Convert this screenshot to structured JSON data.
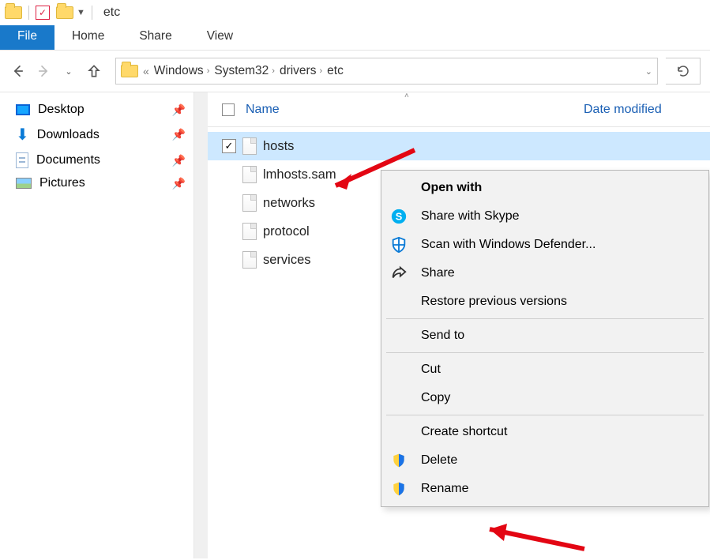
{
  "window": {
    "title": "etc"
  },
  "ribbon": {
    "tabs": {
      "file": "File",
      "home": "Home",
      "share": "Share",
      "view": "View"
    }
  },
  "breadcrumb": {
    "items": [
      "Windows",
      "System32",
      "drivers",
      "etc"
    ]
  },
  "columns": {
    "name": "Name",
    "date_modified": "Date modified"
  },
  "sidebar": {
    "items": [
      {
        "label": "Desktop"
      },
      {
        "label": "Downloads"
      },
      {
        "label": "Documents"
      },
      {
        "label": "Pictures"
      }
    ]
  },
  "files": [
    {
      "name": "hosts",
      "selected": true
    },
    {
      "name": "lmhosts.sam",
      "selected": false
    },
    {
      "name": "networks",
      "selected": false
    },
    {
      "name": "protocol",
      "selected": false
    },
    {
      "name": "services",
      "selected": false
    }
  ],
  "context_menu": {
    "open_with": "Open with",
    "share_skype": "Share with Skype",
    "scan_defender": "Scan with Windows Defender...",
    "share": "Share",
    "restore": "Restore previous versions",
    "send_to": "Send to",
    "cut": "Cut",
    "copy": "Copy",
    "create_shortcut": "Create shortcut",
    "delete": "Delete",
    "rename": "Rename"
  }
}
